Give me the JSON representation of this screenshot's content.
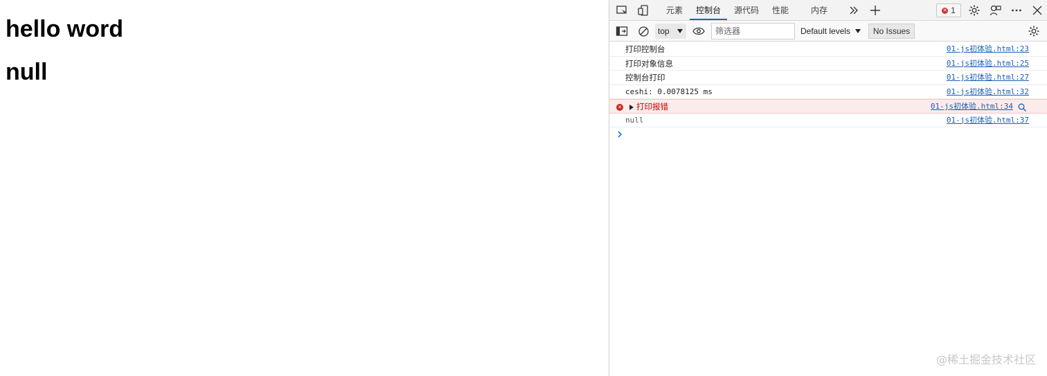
{
  "page": {
    "heading_1": "hello word",
    "heading_2": "null"
  },
  "devtools": {
    "tabs": [
      {
        "label": "元素",
        "active": false
      },
      {
        "label": "控制台",
        "active": true
      },
      {
        "label": "源代码",
        "active": false
      },
      {
        "label": "性能",
        "active": false
      },
      {
        "label": "内存",
        "active": false
      }
    ],
    "error_count": "1",
    "accent_color": "#0f6cbd",
    "toolbar": {
      "context": "top",
      "filter_placeholder": "筛选器",
      "levels": "Default levels",
      "issues": "No Issues"
    },
    "console": [
      {
        "text": "打印控制台",
        "source": "01-js初体验.html:23",
        "kind": "log"
      },
      {
        "text": "打印对象信息",
        "source": "01-js初体验.html:25",
        "kind": "log"
      },
      {
        "text": "控制台打印",
        "source": "01-js初体验.html:27",
        "kind": "log"
      },
      {
        "text": "ceshi: 0.0078125 ms",
        "source": "01-js初体验.html:32",
        "kind": "log"
      },
      {
        "text": "打印报错",
        "source": "01-js初体验.html:34",
        "kind": "error"
      },
      {
        "text": "null",
        "source": "01-js初体验.html:37",
        "kind": "log"
      }
    ]
  },
  "watermark": "@稀土掘金技术社区"
}
